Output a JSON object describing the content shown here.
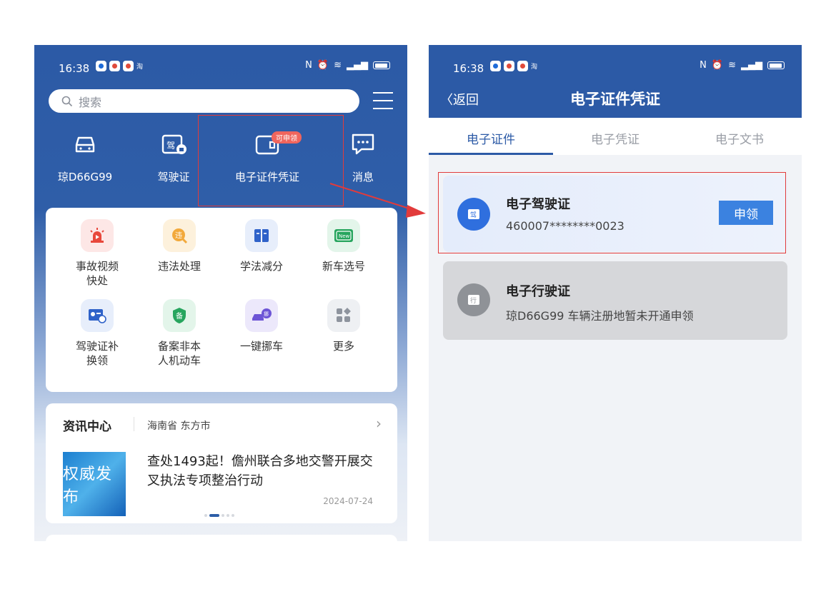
{
  "left_screen": {
    "status": {
      "time": "16:38"
    },
    "search": {
      "placeholder": "搜索"
    },
    "quick_actions": [
      {
        "label": "琼D66G99",
        "icon": "car-icon"
      },
      {
        "label": "驾驶证",
        "icon": "license-icon"
      },
      {
        "label": "电子证件凭证",
        "icon": "e-certificate-icon",
        "badge": "可申领"
      },
      {
        "label": "消息",
        "icon": "message-icon"
      }
    ],
    "services": [
      {
        "label": "事故视频快处",
        "icon": "siren-icon",
        "color": "#fde7e6"
      },
      {
        "label": "违法处理",
        "icon": "violation-icon",
        "color": "#fdf1dc"
      },
      {
        "label": "学法减分",
        "icon": "book-icon",
        "color": "#e7eefb"
      },
      {
        "label": "新车选号",
        "icon": "new-plate-icon",
        "color": "#e3f5ea"
      },
      {
        "label": "驾驶证补换领",
        "icon": "license-renew-icon",
        "color": "#e7eefb"
      },
      {
        "label": "备案非本人机动车",
        "icon": "record-icon",
        "color": "#e3f5ea"
      },
      {
        "label": "一键挪车",
        "icon": "tow-car-icon",
        "color": "#ece8fb"
      },
      {
        "label": "更多",
        "icon": "more-icon",
        "color": "#eef0f3"
      }
    ],
    "news": {
      "section_title": "资讯中心",
      "location": "海南省 东方市",
      "image_text": "权威发布",
      "headline": "查处1493起！儋州联合多地交警开展交叉执法专项整治行动",
      "date": "2024-07-24"
    }
  },
  "right_screen": {
    "status": {
      "time": "16:38"
    },
    "back_label": "返回",
    "title": "电子证件凭证",
    "tabs": [
      "电子证件",
      "电子凭证",
      "电子文书"
    ],
    "active_tab": 0,
    "cards": [
      {
        "name": "电子驾驶证",
        "sub": "460007********0023",
        "icon_text": "驾",
        "action": "申领"
      },
      {
        "name": "电子行驶证",
        "sub": "琼D66G99  车辆注册地暂未开通申领",
        "icon_text": "行"
      }
    ]
  },
  "colors": {
    "header_blue": "#2c5aa6",
    "highlight_red": "#e23b3b",
    "apply_blue": "#3b82e0"
  }
}
